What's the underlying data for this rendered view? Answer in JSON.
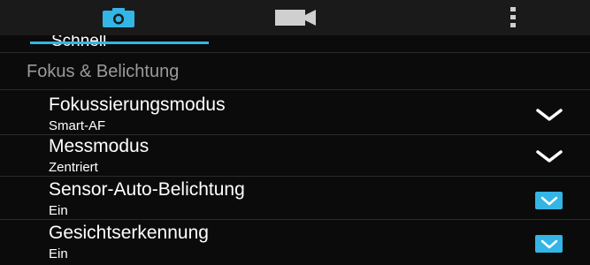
{
  "tabs": {
    "camera_icon": "camera-icon",
    "video_icon": "video-camera-icon",
    "more_icon": "more-vert-icon",
    "accent": "#33b5e5"
  },
  "partial_item_label": "Schnell",
  "section": {
    "header": "Fokus & Belichtung"
  },
  "settings": [
    {
      "title": "Fokussierungsmodus",
      "value": "Smart-AF",
      "control": "dropdown"
    },
    {
      "title": "Messmodus",
      "value": "Zentriert",
      "control": "dropdown"
    },
    {
      "title": "Sensor-Auto-Belichtung",
      "value": "Ein",
      "control": "checkbox",
      "checked": true
    },
    {
      "title": "Gesichtserkennung",
      "value": "Ein",
      "control": "checkbox",
      "checked": true
    }
  ]
}
